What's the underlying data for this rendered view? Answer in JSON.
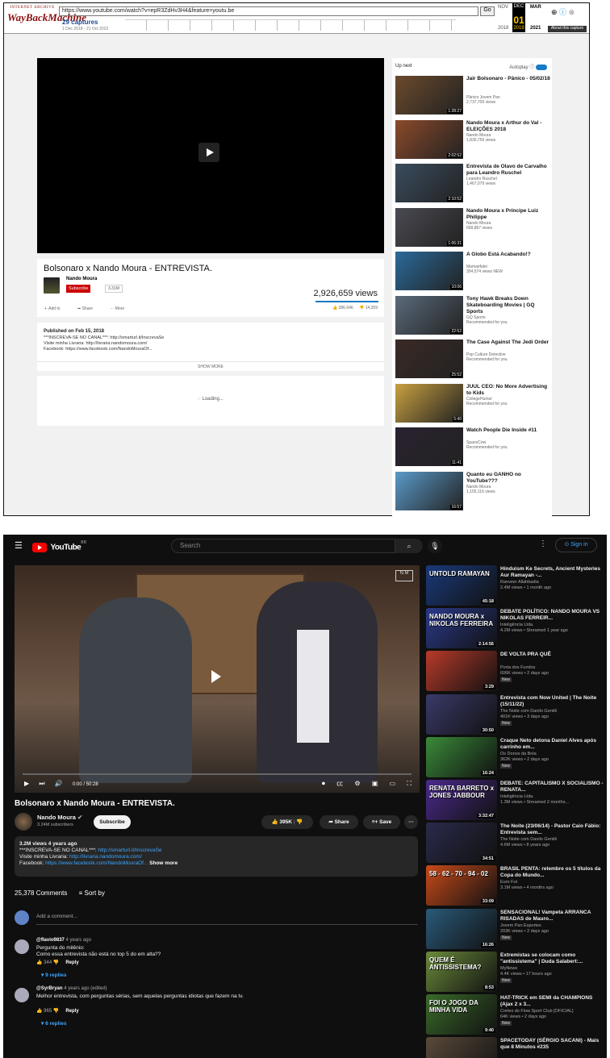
{
  "wayback": {
    "logo_small": "INTERNET ARCHIVE",
    "logo_big": "WayBackMachine",
    "url": "https://www.youtube.com/watch?v=epR3ZdHv3H4&feature=youtu.be",
    "go": "Go",
    "captures": "29 captures",
    "range": "1 Dec 2018 - 21 Oct 2022",
    "month_prev": "NOV",
    "month_cur": "DEC",
    "month_next": "MAR",
    "day": "01",
    "year_prev": "2018",
    "year_cur": "2019",
    "year_next": "2021",
    "about": "About this capture"
  },
  "old": {
    "title": "Bolsonaro x Nando Moura - ENTREVISTA.",
    "channel": "Nando Moura",
    "subscribe": "Subscribe",
    "sub_count": "3.31M",
    "views": "2,926,659 views",
    "add_to": "Add to",
    "share": "Share",
    "more": "More",
    "likes": "386,646",
    "dislikes": "14,359",
    "published": "Published on Feb 15, 2018",
    "desc": [
      "***INSCREVA-SE NO CANAL***: http://smarturl.it/InscrevaSe",
      "Visite minha Livraria: http://livraria.nandomoura.com/",
      "Facebook: https://www.facebook.com/NandoMouraOf..."
    ],
    "show_more": "SHOW MORE",
    "loading": "Loading...",
    "up_next": "Up next",
    "autoplay": "Autoplay",
    "recs": [
      {
        "title": "Jair Bolsonaro - Pânico - 05/02/18",
        "c1": "Pânico Jovem Pan",
        "c2": "2,737,700 views",
        "dur": "1:28:27",
        "color": "#6b4a2c"
      },
      {
        "title": "Nando Moura x Arthur do Val - ELEIÇÕES 2018",
        "c1": "Nando Moura",
        "c2": "1,830,756 views",
        "dur": "2:02:52",
        "color": "#8b4a2a"
      },
      {
        "title": "Entrevista de Olavo de Carvalho para Leandro Ruschel",
        "c1": "Leandro Ruschel",
        "c2": "1,467,079 views",
        "dur": "2:10:52",
        "color": "#3a4c5e"
      },
      {
        "title": "Nando Moura x Príncipe Luiz Philippe",
        "c1": "Nando Moura",
        "c2": "699,867 views",
        "dur": "1:06:31",
        "color": "#4a4a52"
      },
      {
        "title": "A Globo Está Acabando!?",
        "c1": "Mamaefalei",
        "c2": "354,574 views  NEW",
        "dur": "10:06",
        "color": "#2a6a9a"
      },
      {
        "title": "Tony Hawk Breaks Down Skateboarding Movies | GQ Sports",
        "c1": "GQ Sports",
        "c2": "Recommended for you",
        "dur": "22:52",
        "color": "#5a6a7a"
      },
      {
        "title": "The Case Against The Jedi Order",
        "c1": "Pop Culture Detective",
        "c2": "Recommended for you",
        "dur": "25:52",
        "color": "#3a2a26"
      },
      {
        "title": "JUUL CEO: No More Advertising to Kids",
        "c1": "CollegeHumor",
        "c2": "Recommended for you",
        "dur": "5:40",
        "color": "#c8a040"
      },
      {
        "title": "Watch People Die Inside #11",
        "c1": "SpaceCow",
        "c2": "Recommended for you",
        "dur": "11:41",
        "color": "#2a2230"
      },
      {
        "title": "Quanto eu GANHO no YouTube???",
        "c1": "Nando Moura",
        "c2": "1,155,116 views",
        "dur": "16:57",
        "color": "#5a9ac8"
      }
    ]
  },
  "new": {
    "yt_logo": "YouTube",
    "country": "BR",
    "search": "Search",
    "sign_in": "Sign in",
    "time": "0:00 / 50:28",
    "title": "Bolsonaro x Nando Moura - ENTREVISTA.",
    "channel": "Nando Moura",
    "subs": "3.24M subscribers",
    "subscribe": "Subscribe",
    "likes": "395K",
    "share": "Share",
    "save": "Save",
    "meta": "3.2M views  4 years ago",
    "desc1": "***INSCREVA-SE NO CANAL***: ",
    "link1": "http://smarturl.it/InscrevaSe",
    "desc2": "Visite minha Livraria: ",
    "link2": "http://livraria.nandomoura.com/",
    "desc3": "Facebook: ",
    "link3": "https://www.facebook.com/NandoMouraOf...",
    "show_more": "Show more",
    "comments_count": "25,378 Comments",
    "sort": "Sort by",
    "add_comment": "Add a comment...",
    "comments": [
      {
        "author": "@flavio9837",
        "when": "4 years ago",
        "text": "Pergunta do milênio:\nComo essa entrevista não está no top 5 do em alta??",
        "likes": "344",
        "reply": "Reply",
        "replies": "9 replies"
      },
      {
        "author": "@SyrBryan",
        "when": "4 years ago (edited)",
        "text": "Melhor entrevista, com perguntas sérias, sem aquelas perguntas idiotas que fazem na tv.",
        "likes": "965",
        "reply": "Reply",
        "replies": "6 replies"
      }
    ],
    "recs": [
      {
        "title": "Hinduism Ke Secrets, Ancient Mysteries Aur Ramayan -...",
        "c1": "Ranveer Allahbadia",
        "c2": "2.4M views • 1 month ago",
        "new": "",
        "dur": "45:18",
        "thumb": "UNTOLD RAMAYAN",
        "color": "#1a3a7a"
      },
      {
        "title": "DEBATE POLÍTICO: NANDO MOURA VS NIKOLAS FERREIR...",
        "c1": "Inteligência Ltda.",
        "c2": "4.2M views • Streamed 1 year ago",
        "new": "",
        "dur": "2:14:56",
        "thumb": "NANDO MOURA x NIKOLAS FERREIRA",
        "color": "#2a3a8a"
      },
      {
        "title": "DE VOLTA PRA QUÊ",
        "c1": "Porta dos Fundos",
        "c2": "606K views • 2 days ago",
        "new": "New",
        "dur": "3:29",
        "thumb": "",
        "color": "#b83a2a"
      },
      {
        "title": "Entrevista com Now United | The Noite (15/11/22)",
        "c1": "The Noite com Danilo Gentili",
        "c2": "401K views • 3 days ago",
        "new": "New",
        "dur": "30:50",
        "thumb": "",
        "color": "#3a3a6a"
      },
      {
        "title": "Craque Neto detona Daniel Alves após carrinho em...",
        "c1": "Os Donos da Bola",
        "c2": "362K views • 2 days ago",
        "new": "New",
        "dur": "16:24",
        "thumb": "",
        "color": "#3a8a3a"
      },
      {
        "title": "DEBATE: CAPITALISMO X SOCIALISMO - RENATA...",
        "c1": "Inteligência Ltda.",
        "c2": "1.3M views • Streamed 2 months...",
        "new": "",
        "dur": "3:32:47",
        "thumb": "RENATA BARRETO x JONES JABBOUR",
        "color": "#4a2a8a"
      },
      {
        "title": "The Noite (23/06/14) - Pastor Caio Fábio: Entrevista sem...",
        "c1": "The Noite com Danilo Gentili",
        "c2": "4.6M views • 8 years ago",
        "new": "",
        "dur": "34:51",
        "thumb": "",
        "color": "#2a2a4a"
      },
      {
        "title": "BRASIL PENTA: relembre os 5 títulos da Copa do Mundo...",
        "c1": "Euro Fut",
        "c2": "3.1M views • 4 months ago",
        "new": "",
        "dur": "33:09",
        "thumb": "58 - 62 - 70 - 94 - 02",
        "color": "#c84a1a"
      },
      {
        "title": "SENSACIONAL! Vampeta ARRANCA RISADAS de Mauro...",
        "c1": "Jovem Pan Esportes",
        "c2": "203K views • 2 days ago",
        "new": "New",
        "dur": "16:26",
        "thumb": "",
        "color": "#2a5a7a"
      },
      {
        "title": "Extremistas se colocam como \"antissistema\" | Duda Salabert:...",
        "c1": "MyNews",
        "c2": "4.4K views • 17 hours ago",
        "new": "New",
        "dur": "8:53",
        "thumb": "QUEM É ANTISSISTEMA?",
        "color": "#6a8a3a"
      },
      {
        "title": "HAT-TRICK em SEMI da CHAMPIONS (Ajax 2 x 3...",
        "c1": "Cortes do Flow Sport Club [OFICIAL]",
        "c2": "64K views • 2 days ago",
        "new": "New",
        "dur": "9:40",
        "thumb": "FOI O JOGO DA MINHA VIDA",
        "color": "#3a6a2a"
      },
      {
        "title": "SPACETODAY (SÉRGIO SACANI) - Mais que 8 Minutos #235",
        "c1": "",
        "c2": "",
        "new": "",
        "dur": "",
        "thumb": "",
        "color": "#5a4a3a"
      }
    ]
  }
}
